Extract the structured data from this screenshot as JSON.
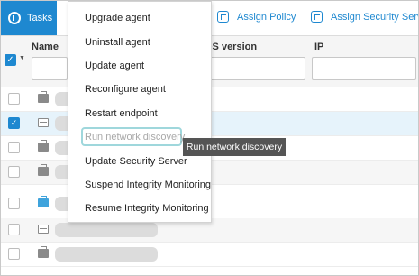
{
  "toolbar": {
    "tasks_label": "Tasks",
    "assign_policy_label": "Assign Policy",
    "assign_security_server_label": "Assign Security Serve"
  },
  "columns": {
    "name": "Name",
    "os_version": "OS version",
    "ip": "IP"
  },
  "rows": [
    {
      "checked": false,
      "icon": "endpoint-icon"
    },
    {
      "checked": true,
      "icon": "security-server-icon"
    },
    {
      "checked": false,
      "icon": "endpoint-icon"
    },
    {
      "checked": false,
      "icon": "endpoint-icon"
    },
    {
      "checked": false,
      "icon": "endpoint-blue-icon"
    },
    {
      "checked": false,
      "icon": "security-server-icon"
    },
    {
      "checked": false,
      "icon": "endpoint-icon"
    }
  ],
  "menu": {
    "items": [
      "Upgrade agent",
      "Uninstall agent",
      "Update agent",
      "Reconfigure agent",
      "Restart endpoint",
      "Run network discovery",
      "Update Security Server",
      "Suspend Integrity Monitoring",
      "Resume Integrity Monitoring"
    ],
    "disabled_index": 5
  },
  "tooltip": "Run network discovery",
  "colors": {
    "accent": "#1e88d0",
    "selected_row": "#e6f3fb",
    "focus_outline": "#9fd7dc",
    "tooltip_bg": "#555555"
  }
}
